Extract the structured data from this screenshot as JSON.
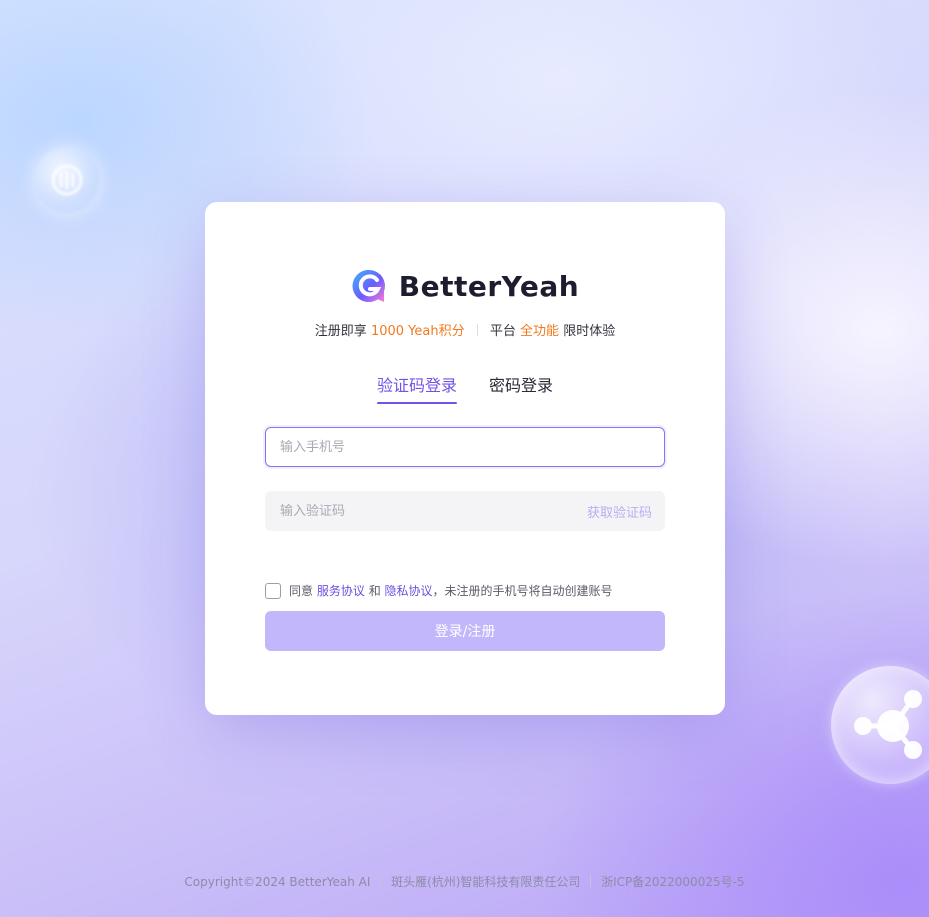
{
  "brand": {
    "name": "BetterYeah",
    "mark_colors": [
      "#6a5cff",
      "#3fb4ff",
      "#ff7bd5"
    ]
  },
  "tagline": {
    "part1": "注册即享",
    "highlight1": "1000 Yeah积分",
    "part2": "平台",
    "highlight2": "全功能",
    "part3": "限时体验"
  },
  "tabs": [
    {
      "label": "验证码登录",
      "active": true
    },
    {
      "label": "密码登录",
      "active": false
    }
  ],
  "form": {
    "phone_placeholder": "输入手机号",
    "code_placeholder": "输入验证码",
    "get_code_label": "获取验证码",
    "agree_prefix": "同意",
    "service_link": "服务协议",
    "and_text": "和",
    "privacy_link": "隐私协议",
    "agree_suffix": "，未注册的手机号将自动创建账号",
    "submit_label": "登录/注册"
  },
  "footer": {
    "copyright": "Copyright©2024  BetterYeah AI",
    "company": "斑头雁(杭州)智能科技有限责任公司",
    "icp": "浙ICP备2022000025号-5"
  },
  "colors": {
    "accent": "#7352e6",
    "highlight": "#f07a1f",
    "submit_bg": "#c2b7fb"
  }
}
